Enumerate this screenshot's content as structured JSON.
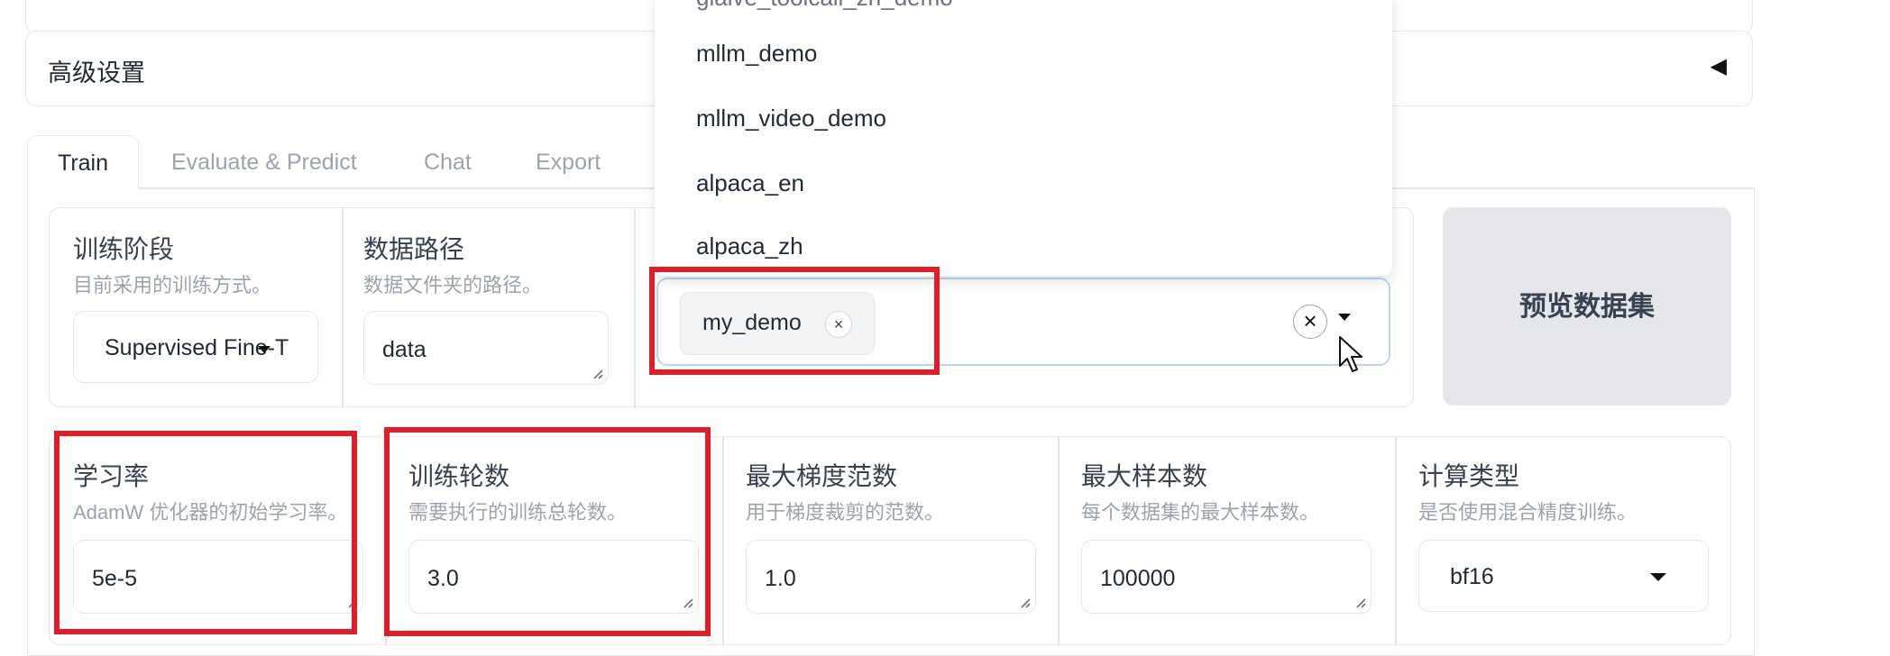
{
  "accordion": {
    "title": "高级设置",
    "arrow": "◀"
  },
  "tabs": [
    {
      "label": "Train",
      "active": true
    },
    {
      "label": "Evaluate & Predict",
      "active": false
    },
    {
      "label": "Chat",
      "active": false
    },
    {
      "label": "Export",
      "active": false
    }
  ],
  "row1": {
    "stage": {
      "label": "训练阶段",
      "sub": "目前采用的训练方式。",
      "value": "Supervised Fine-T"
    },
    "data_path": {
      "label": "数据路径",
      "sub": "数据文件夹的路径。",
      "value": "data"
    },
    "dataset": {
      "chip": "my_demo",
      "chip_remove": "×",
      "clear": "×"
    },
    "preview_label": "预览数据集"
  },
  "dropdown": {
    "items": [
      "glaive_toolcall_zh_demo",
      "mllm_demo",
      "mllm_video_demo",
      "alpaca_en",
      "alpaca_zh"
    ]
  },
  "row2": [
    {
      "label": "学习率",
      "sub": "AdamW 优化器的初始学习率。",
      "value": "5e-5"
    },
    {
      "label": "训练轮数",
      "sub": "需要执行的训练总轮数。",
      "value": "3.0"
    },
    {
      "label": "最大梯度范数",
      "sub": "用于梯度裁剪的范数。",
      "value": "1.0"
    },
    {
      "label": "最大样本数",
      "sub": "每个数据集的最大样本数。",
      "value": "100000"
    },
    {
      "label": "计算类型",
      "sub": "是否使用混合精度训练。",
      "value": "bf16"
    }
  ],
  "colors": {
    "highlight": "#e01e25",
    "focus_border": "#b6d7f5",
    "muted": "#9ca3af"
  }
}
